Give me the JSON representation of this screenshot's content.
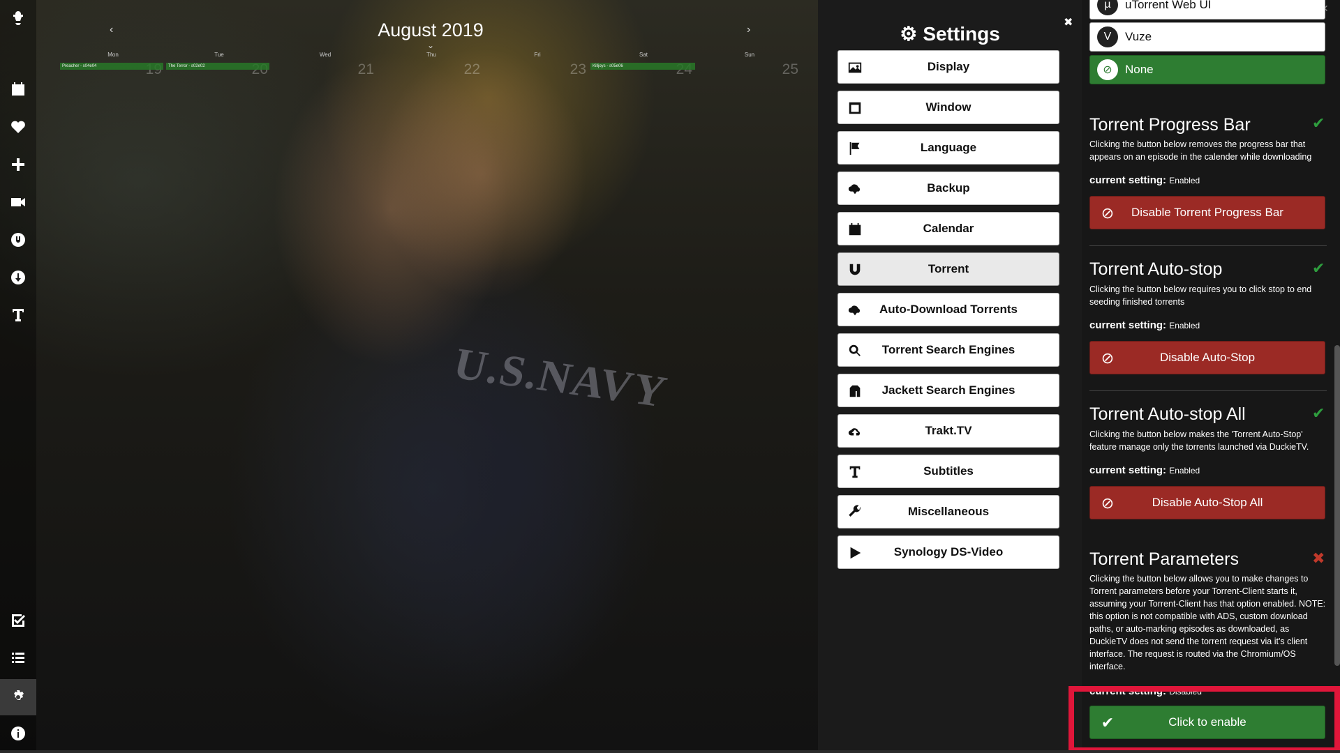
{
  "calendar": {
    "title": "August 2019",
    "prev": "‹",
    "next": "›",
    "days": [
      {
        "name": "Mon",
        "num": "19"
      },
      {
        "name": "Tue",
        "num": "20"
      },
      {
        "name": "Wed",
        "num": "21"
      },
      {
        "name": "Thu",
        "num": "22"
      },
      {
        "name": "Fri",
        "num": "23"
      },
      {
        "name": "Sat",
        "num": "24"
      },
      {
        "name": "Sun",
        "num": "25"
      }
    ],
    "events": [
      {
        "label": "Preacher - s04e04"
      },
      {
        "label": "The Terror - s02e02"
      },
      {
        "label": "Killjoys - s05e06"
      }
    ]
  },
  "sidebar": {
    "icons": [
      "logo-icon",
      "calendar-icon",
      "heart-icon",
      "plus-icon",
      "video-camera-icon",
      "torrent-client-icon",
      "download-icon",
      "subtitles-icon",
      "checklist-icon",
      "list-icon",
      "gear-icon",
      "info-icon"
    ]
  },
  "settings": {
    "title": "Settings",
    "close": "✖",
    "menu": [
      {
        "label": "Display",
        "icon": "image-icon"
      },
      {
        "label": "Window",
        "icon": "window-icon"
      },
      {
        "label": "Language",
        "icon": "flag-icon"
      },
      {
        "label": "Backup",
        "icon": "cloud-download-icon"
      },
      {
        "label": "Calendar",
        "icon": "calendar-icon"
      },
      {
        "label": "Torrent",
        "icon": "magnet-icon"
      },
      {
        "label": "Auto-Download Torrents",
        "icon": "cloud-download-icon"
      },
      {
        "label": "Torrent Search Engines",
        "icon": "search-icon"
      },
      {
        "label": "Jackett Search Engines",
        "icon": "jacket-icon"
      },
      {
        "label": "Trakt.TV",
        "icon": "cloud-upload-icon"
      },
      {
        "label": "Subtitles",
        "icon": "subtitles-icon"
      },
      {
        "label": "Miscellaneous",
        "icon": "wrench-icon"
      },
      {
        "label": "Synology DS-Video",
        "icon": "play-icon"
      }
    ],
    "active_item": "Torrent"
  },
  "clients": [
    {
      "label": "uTorrent Web UI",
      "selected": false
    },
    {
      "label": "Vuze",
      "selected": false
    },
    {
      "label": "None",
      "selected": true
    }
  ],
  "sections": [
    {
      "title": "Torrent Progress Bar",
      "status": "enabled",
      "desc": "Clicking the button below removes the progress bar that appears on an episode in the calender while downloading",
      "current_label": "current setting:",
      "current_value": "Enabled",
      "button": "Disable Torrent Progress Bar"
    },
    {
      "title": "Torrent Auto-stop",
      "status": "enabled",
      "desc": "Clicking the button below requires you to click stop to end seeding finished torrents",
      "current_label": "current setting:",
      "current_value": "Enabled",
      "button": "Disable Auto-Stop"
    },
    {
      "title": "Torrent Auto-stop All",
      "status": "enabled",
      "desc": "Clicking the button below makes the 'Torrent Auto-Stop' feature manage only the torrents launched via DuckieTV.",
      "current_label": "current setting:",
      "current_value": "Enabled",
      "button": "Disable Auto-Stop All"
    },
    {
      "title": "Torrent Parameters",
      "status": "disabled",
      "desc": "Clicking the button below allows you to make changes to Torrent parameters before your Torrent-Client starts it, assuming your Torrent-Client has that option enabled. NOTE: this option is not compatible with ADS, custom download paths, or auto-marking episodes as downloaded, as DuckieTV does not send the torrent request via it's client interface. The request is routed via the Chromium/OS interface.",
      "current_label": "current setting:",
      "current_value": "Disabled",
      "button": "Click to enable"
    }
  ],
  "colors": {
    "enabled_check": "#2e9d3e",
    "disabled_x": "#c0392b",
    "disable_button": "#9b2a25",
    "enable_button": "#2e7d32",
    "highlight": "#e0163a"
  }
}
